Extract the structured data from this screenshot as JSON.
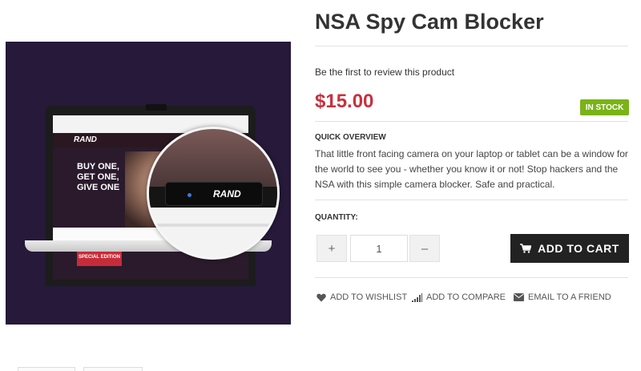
{
  "product": {
    "title": "NSA Spy Cam Blocker",
    "review_link": "Be the first to review this product",
    "price": "$15.00",
    "stock_badge": "IN STOCK",
    "overview_heading": "QUICK OVERVIEW",
    "overview_text": "That little front facing camera on your laptop or tablet can be a window for the world to see you - whether you know it or not! Stop hackers and the NSA with this simple camera blocker. Safe and practical."
  },
  "image": {
    "site_logo": "RAND",
    "hero_text": "BUY ONE, GET ONE, GIVE ONE",
    "special_edition": "SPECIAL EDITION",
    "blocker_brand": "RAND"
  },
  "quantity": {
    "label": "QUANTITY:",
    "plus": "+",
    "value": "1",
    "minus": "–"
  },
  "cart": {
    "label": "ADD TO CART",
    "icon": "cart-icon"
  },
  "actions": {
    "wishlist": "ADD TO WISHLIST",
    "compare": "ADD TO COMPARE",
    "email": "EMAIL TO A FRIEND"
  },
  "colors": {
    "price": "#c8313d",
    "stock": "#7ab317",
    "cart_button": "#222222",
    "image_background": "#26193a"
  }
}
